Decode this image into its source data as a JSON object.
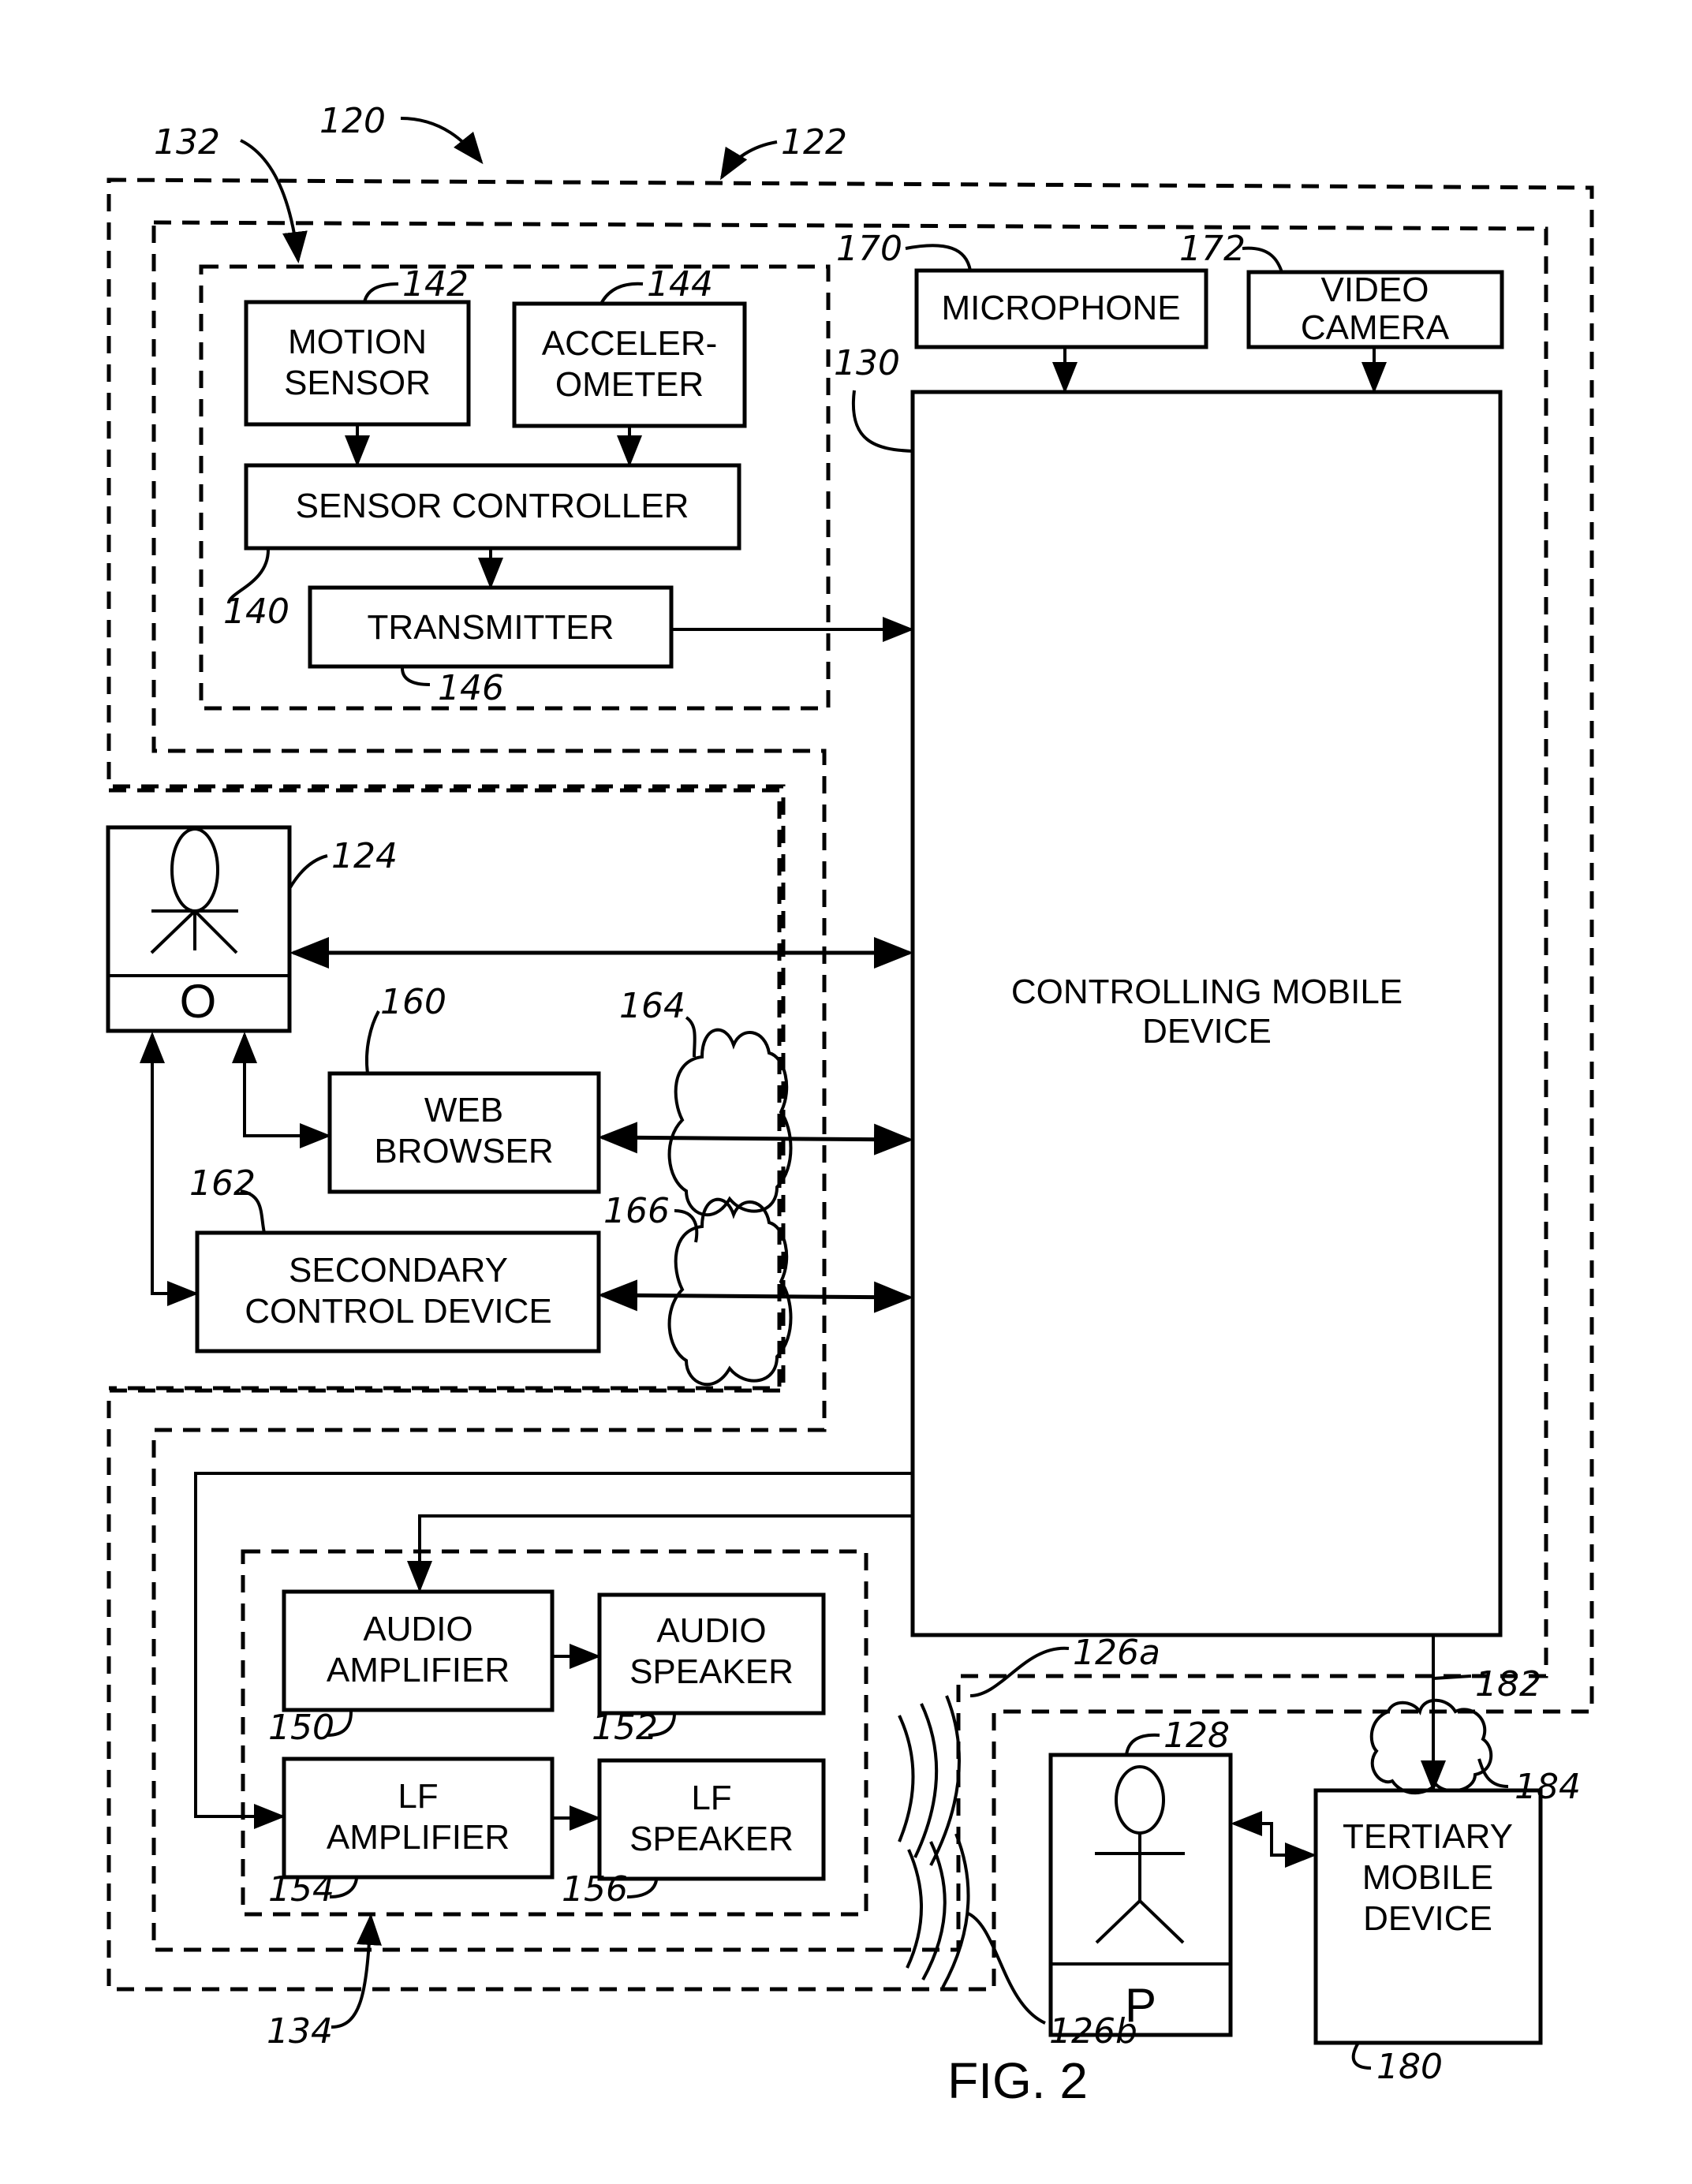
{
  "figure": {
    "caption": "FIG. 2",
    "system_ref": "120"
  },
  "groups": {
    "outer": {
      "ref": "122"
    },
    "sensor_group": {
      "ref": "132"
    },
    "output_group": {
      "ref": "134"
    }
  },
  "blocks": {
    "motion_sensor": {
      "lines": [
        "MOTION",
        "SENSOR"
      ],
      "ref": "142"
    },
    "accelerometer": {
      "lines": [
        "ACCELER-",
        "OMETER"
      ],
      "ref": "144"
    },
    "sensor_controller": {
      "lines": [
        "SENSOR CONTROLLER"
      ],
      "ref": "140"
    },
    "transmitter": {
      "lines": [
        "TRANSMITTER"
      ],
      "ref": "146"
    },
    "microphone": {
      "lines": [
        "MICROPHONE"
      ],
      "ref": "170"
    },
    "video_camera": {
      "lines": [
        "VIDEO",
        "CAMERA"
      ],
      "ref": "172"
    },
    "controlling_mobile_device": {
      "lines": [
        "CONTROLLING MOBILE",
        "DEVICE"
      ],
      "ref": "130"
    },
    "web_browser": {
      "lines": [
        "WEB",
        "BROWSER"
      ],
      "ref": "160"
    },
    "secondary_control_device": {
      "lines": [
        "SECONDARY",
        "CONTROL DEVICE"
      ],
      "ref": "162"
    },
    "audio_amplifier": {
      "lines": [
        "AUDIO",
        "AMPLIFIER"
      ],
      "ref": "150"
    },
    "audio_speaker": {
      "lines": [
        "AUDIO",
        "SPEAKER"
      ],
      "ref": "152"
    },
    "lf_amplifier": {
      "lines": [
        "LF",
        "AMPLIFIER"
      ],
      "ref": "154"
    },
    "lf_speaker": {
      "lines": [
        "LF",
        "SPEAKER"
      ],
      "ref": "156"
    },
    "tertiary_mobile_device": {
      "lines": [
        "TERTIARY",
        "MOBILE",
        "DEVICE"
      ],
      "ref": "180"
    }
  },
  "people": {
    "operator": {
      "letter": "O",
      "ref": "124"
    },
    "participant": {
      "letter": "P",
      "ref": "128"
    }
  },
  "networks": {
    "cloud_web": {
      "ref": "164"
    },
    "cloud_secondary": {
      "ref": "166"
    },
    "cloud_tertiary": {
      "ref": "184"
    },
    "link_tertiary": {
      "ref": "182"
    }
  },
  "sound_waves": {
    "audio_wave": {
      "ref": "126a"
    },
    "lf_wave": {
      "ref": "126b"
    }
  }
}
